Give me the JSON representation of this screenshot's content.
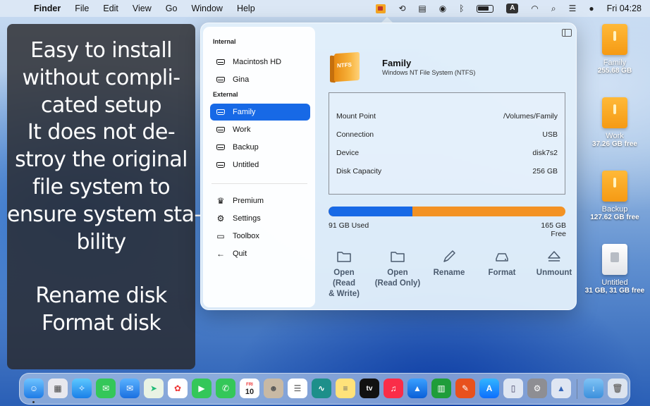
{
  "menubar": {
    "app_name": "Finder",
    "menus": [
      "File",
      "Edit",
      "View",
      "Go",
      "Window",
      "Help"
    ],
    "clock": "Fri 04:28",
    "input_indicator": "A"
  },
  "promo": {
    "lines": [
      "Easy to install",
      "without compli-",
      "cated setup",
      "It does not de-",
      "stroy the original",
      "file system to",
      "ensure system sta-",
      "bility"
    ],
    "lines2": [
      "Rename disk",
      "Format disk"
    ]
  },
  "sidebar": {
    "internal_header": "Internal",
    "internal": [
      "Macintosh HD",
      "Gina"
    ],
    "external_header": "External",
    "external": [
      "Family",
      "Work",
      "Backup",
      "Untitled"
    ],
    "selected": "Family",
    "menu": [
      "Premium",
      "Settings",
      "Toolbox",
      "Quit"
    ]
  },
  "detail": {
    "disk_name": "Family",
    "fs": "Windows NT File System (NTFS)",
    "badge": "NTFS",
    "info": [
      {
        "key": "Mount Point",
        "value": "/Volumes/Family"
      },
      {
        "key": "Connection",
        "value": "USB"
      },
      {
        "key": "Device",
        "value": "disk7s2"
      },
      {
        "key": "Disk Capacity",
        "value": "256 GB"
      }
    ],
    "used_label": "91 GB Used",
    "free_label": "165 GB Free",
    "used_fraction": 0.355,
    "actions": [
      {
        "label": "Open (Read & Write)",
        "icon": "folder-icon"
      },
      {
        "label": "Open (Read Only)",
        "icon": "folder-icon"
      },
      {
        "label": "Rename",
        "icon": "pencil-icon"
      },
      {
        "label": "Format",
        "icon": "drive-icon"
      },
      {
        "label": "Unmount",
        "icon": "eject-icon"
      }
    ]
  },
  "desktop": [
    {
      "name": "Family",
      "size": "255.68 GB"
    },
    {
      "name": "Work",
      "size": "37.26 GB free"
    },
    {
      "name": "Backup",
      "size": "127.62 GB free"
    },
    {
      "name": "Untitled",
      "size": "31 GB, 31 GB free"
    }
  ],
  "dock": {
    "calendar_day": "10",
    "calendar_month": "FRI"
  },
  "colors": {
    "accent": "#1769e6",
    "free": "#f39224",
    "drive": "#f59a14"
  }
}
